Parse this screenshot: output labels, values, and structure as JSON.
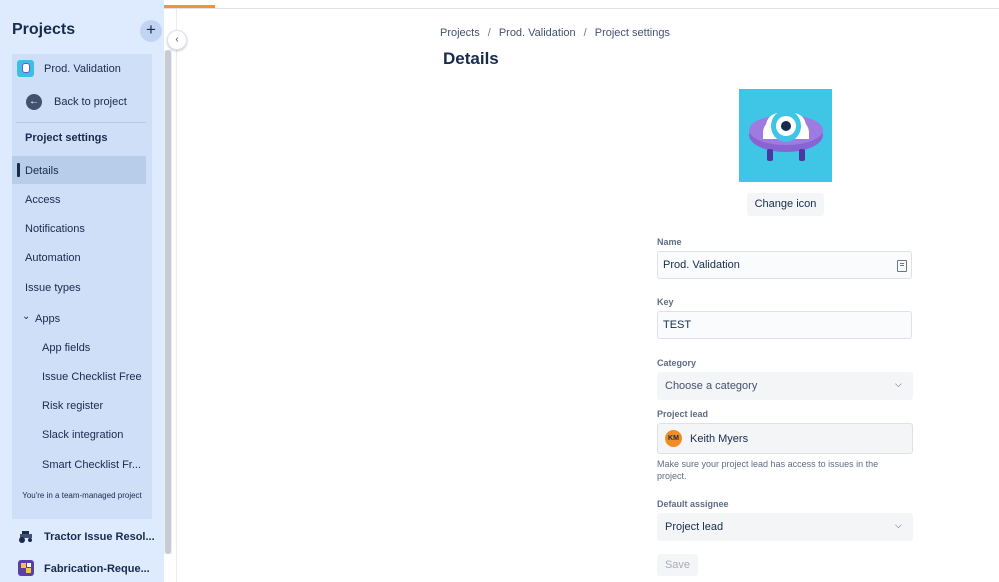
{
  "sidebar": {
    "header": "Projects",
    "add_label": "+",
    "current_project": "Prod. Validation",
    "back_label": "Back to project",
    "section_heading": "Project settings",
    "items": [
      {
        "label": "Details",
        "active": true
      },
      {
        "label": "Access"
      },
      {
        "label": "Notifications"
      },
      {
        "label": "Automation"
      },
      {
        "label": "Issue types"
      },
      {
        "label": "Apps",
        "expanded": true
      }
    ],
    "app_items": [
      {
        "label": "App fields"
      },
      {
        "label": "Issue Checklist Free"
      },
      {
        "label": "Risk register"
      },
      {
        "label": "Slack integration"
      },
      {
        "label": "Smart Checklist Fr..."
      }
    ],
    "team_note": "You're in a team-managed project",
    "other_projects": [
      {
        "name": "Tractor Issue Resol...",
        "icon": "tractor-icon"
      },
      {
        "name": "Fabrication-Reque...",
        "icon": "fabrication-icon"
      }
    ]
  },
  "breadcrumb": [
    "Projects",
    "Prod. Validation",
    "Project settings"
  ],
  "page_title": "Details",
  "change_icon_label": "Change icon",
  "form": {
    "name_label": "Name",
    "name_value": "Prod. Validation",
    "key_label": "Key",
    "key_value": "TEST",
    "category_label": "Category",
    "category_placeholder": "Choose a category",
    "lead_label": "Project lead",
    "lead_initials": "KM",
    "lead_name": "Keith Myers",
    "lead_helper": "Make sure your project lead has access to issues in the project.",
    "assignee_label": "Default assignee",
    "assignee_value": "Project lead",
    "save_label": "Save"
  },
  "colors": {
    "sidebar_bg": "#deebff",
    "accent": "#f79232",
    "project_icon_bg": "#3fc5e5",
    "lead_avatar_bg": "#f28d24"
  }
}
